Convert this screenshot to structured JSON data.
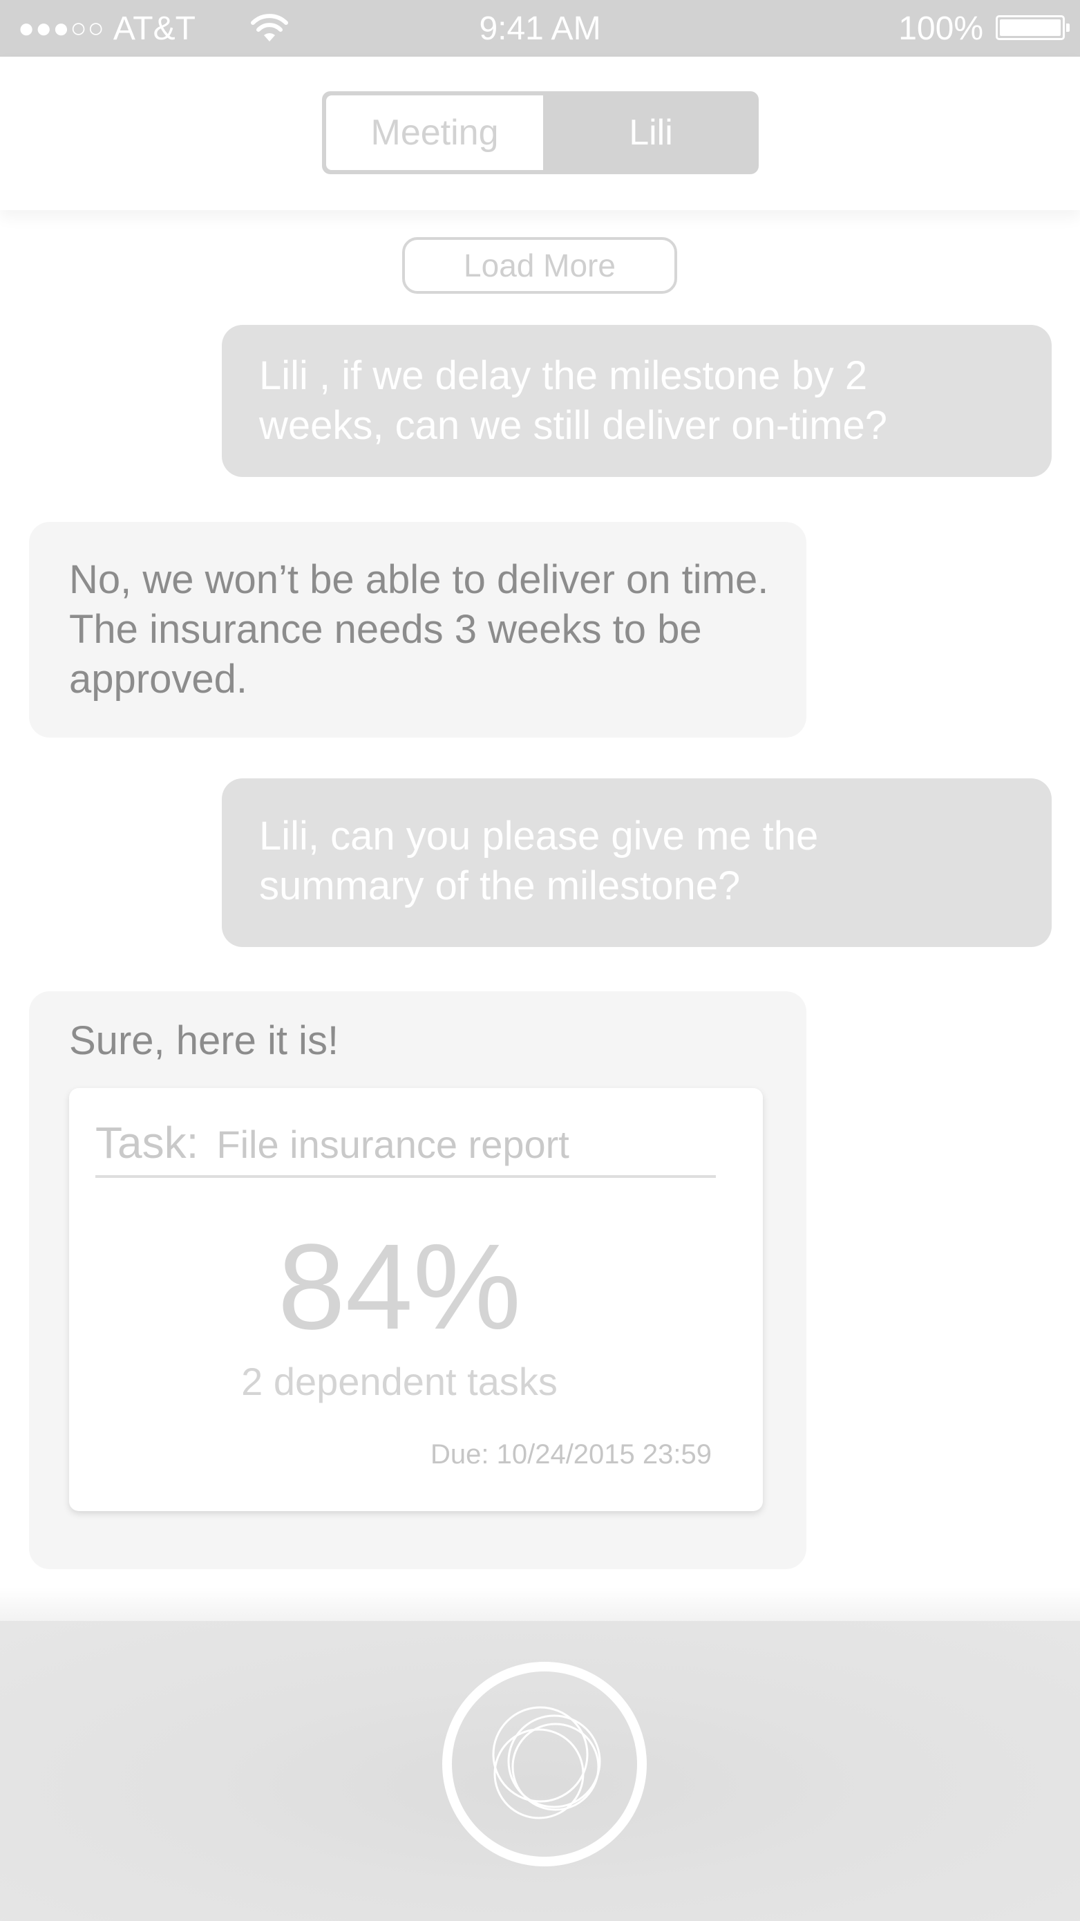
{
  "status_bar": {
    "signal": "●●●○○",
    "carrier": "AT&T",
    "time": "9:41 AM",
    "battery": "100%"
  },
  "tabs": {
    "items": [
      "Meeting",
      "Lili"
    ],
    "selected": "Lili"
  },
  "chat": {
    "load_more": "Load More",
    "messages": [
      {
        "sender": "user",
        "text": "Lili , if we delay the milestone by 2 weeks, can we still deliver on-time?"
      },
      {
        "sender": "bot",
        "text": "No, we won’t be able to deliver on time. The insurance needs 3 weeks to be approved."
      },
      {
        "sender": "user",
        "text": "Lili, can you please give me the summary of the milestone?"
      },
      {
        "sender": "bot",
        "text": "Sure, here it is!"
      }
    ]
  },
  "task_card": {
    "label": "Task:",
    "name": "File insurance report",
    "percent": "84%",
    "dependent": "2 dependent tasks",
    "due": "Due: 10/24/2015 23:59"
  },
  "icons": {
    "wifi": "wifi-icon",
    "battery": "battery-icon",
    "assistant": "voice-assistant-icon"
  },
  "colors": {
    "status_bar": "#d2d2d2",
    "user_bubble": "#e0e0e0",
    "bot_bubble": "#f5f5f5",
    "bottom_bar": "#e2e2e2"
  }
}
